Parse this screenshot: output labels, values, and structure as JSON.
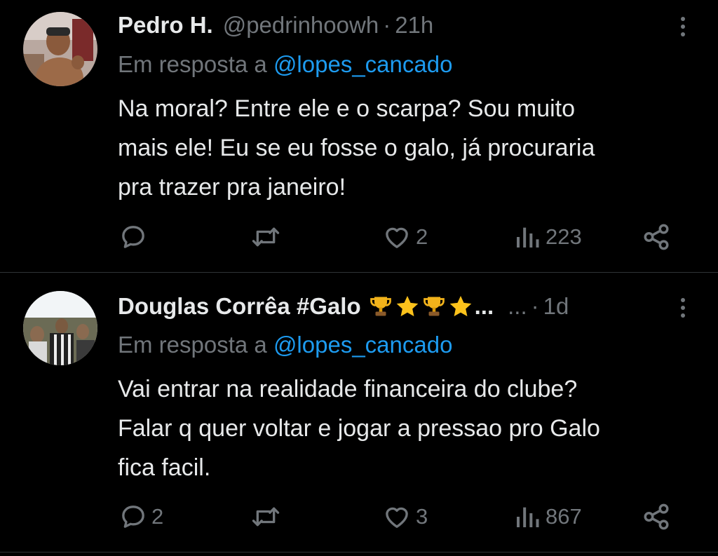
{
  "tweets": [
    {
      "display_name": "Pedro H.",
      "handle": "@pedrinhoowh",
      "separator": "·",
      "time": "21h",
      "reply_prefix": "Em resposta a",
      "reply_mention": "@lopes_cancado",
      "text": "Na moral? Entre ele e o scarpa? Sou muito\nmais ele! Eu se eu fosse o galo, já procuraria\npra trazer pra janeiro!",
      "actions": {
        "reply_count": "",
        "retweet_count": "",
        "like_count": "2",
        "views_count": "223"
      }
    },
    {
      "display_name": "Douglas Corrêa #Galo",
      "name_emojis": [
        "trophy-icon",
        "star-icon",
        "trophy-icon",
        "star-icon"
      ],
      "name_tail": "...",
      "truncated_handle": "...",
      "separator": "·",
      "time": "1d",
      "reply_prefix": "Em resposta a",
      "reply_mention": "@lopes_cancado",
      "text": "Vai entrar na realidade financeira do clube?\nFalar q quer voltar e jogar a pressao pro Galo\nfica facil.",
      "actions": {
        "reply_count": "2",
        "retweet_count": "",
        "like_count": "3",
        "views_count": "867"
      }
    }
  ],
  "colors": {
    "background": "#000000",
    "text_primary": "#e7e9ea",
    "text_secondary": "#71767b",
    "link": "#1d9bf0",
    "divider": "#2f3336"
  }
}
